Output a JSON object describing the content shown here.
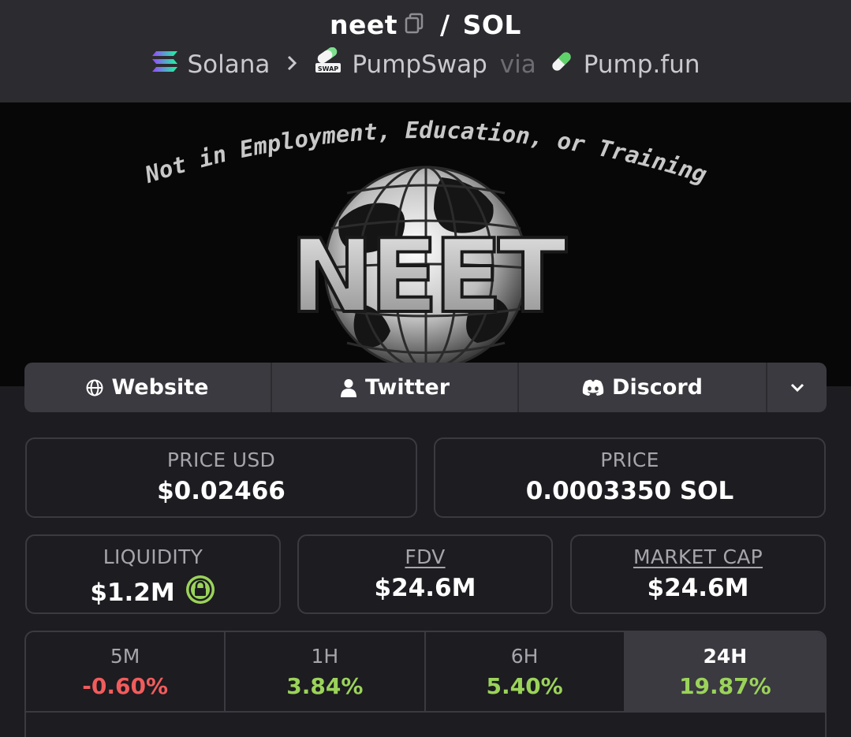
{
  "header": {
    "token_symbol": "neet",
    "separator": "/",
    "quote_symbol": "SOL",
    "chain": "Solana",
    "dex": "PumpSwap",
    "dex_badge": "SWAP",
    "via_label": "via",
    "launchpad": "Pump.fun"
  },
  "banner": {
    "tagline": "Not in Employment, Education, or Training",
    "logo_text": "NEET"
  },
  "links": {
    "website": "Website",
    "twitter": "Twitter",
    "discord": "Discord"
  },
  "stats": {
    "price_usd_label": "PRICE USD",
    "price_usd": "$0.02466",
    "price_label": "PRICE",
    "price_native": "0.0003350 SOL",
    "liquidity_label": "LIQUIDITY",
    "liquidity": "$1.2M",
    "fdv_label": "FDV",
    "fdv": "$24.6M",
    "mcap_label": "MARKET CAP",
    "mcap": "$24.6M"
  },
  "changes": [
    {
      "period": "5M",
      "value": "-0.60%"
    },
    {
      "period": "1H",
      "value": "3.84%"
    },
    {
      "period": "6H",
      "value": "5.40%"
    },
    {
      "period": "24H",
      "value": "19.87%"
    }
  ],
  "colors": {
    "negative": "#f25c5c",
    "positive": "#9bd35a",
    "lock_badge": "#9bd35a"
  }
}
